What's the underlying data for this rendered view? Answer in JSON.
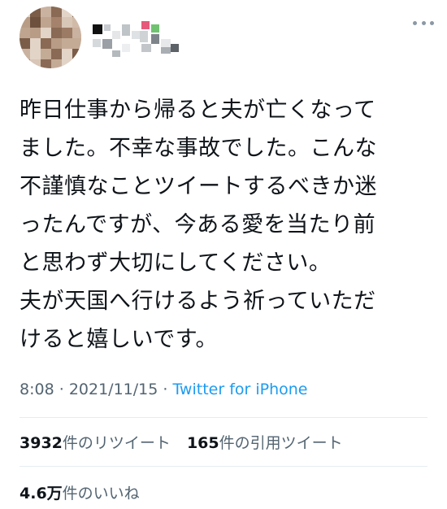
{
  "tweet": {
    "text_lines": [
      "昨日仕事から帰ると夫が亡くなって",
      "ました。不幸な事故でした。こんな",
      "不謹慎なことツイートするべきか迷",
      "ったんですが、今ある愛を当たり前",
      "と思わず大切にしてください。",
      "夫が天国へ行けるよう祈っていただ",
      "けると嬉しいです。"
    ],
    "time": "8:08",
    "date": "2021/11/15",
    "source": "Twitter for iPhone"
  },
  "stats": {
    "retweets_count": "3932",
    "retweets_label": "件のリツイート",
    "quotes_count": "165",
    "quotes_label": "件の引用ツイート",
    "likes_count": "4.6万",
    "likes_label": "件のいいね"
  },
  "icons": {
    "more": "more-horizontal-icon"
  },
  "colors": {
    "text": "#0f1419",
    "secondary": "#536471",
    "link": "#1d9bf0",
    "divider": "#e6ecf0"
  }
}
